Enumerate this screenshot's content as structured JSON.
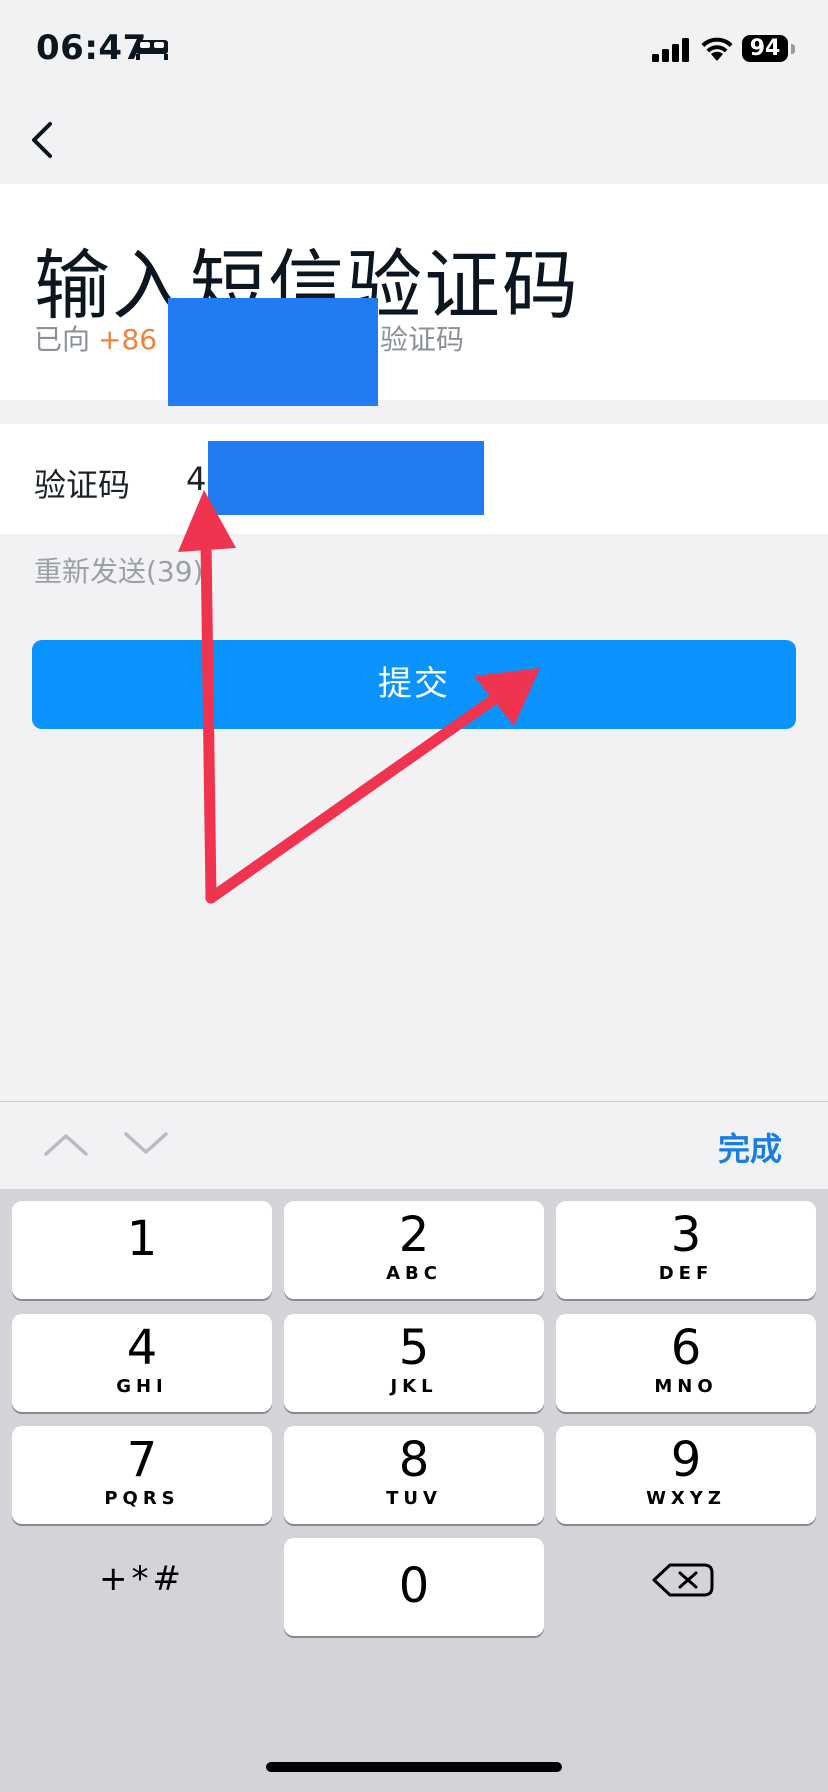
{
  "status_bar": {
    "time": "06:47",
    "battery_level": "94",
    "icons": [
      "sleep-focus-icon",
      "cellular-signal-icon",
      "wifi-icon",
      "battery-icon"
    ]
  },
  "nav": {
    "back_icon": "chevron-left-icon"
  },
  "header": {
    "title": "输入短信验证码",
    "sent_prefix": "已向",
    "sent_phone_visible": "+86 1",
    "sent_suffix": "验证码"
  },
  "form": {
    "code_label": "验证码",
    "code_value": "4",
    "resend_label": "重新发送(39)",
    "submit_label": "提交"
  },
  "annotation": {
    "arrow_color": "#f0344f"
  },
  "keyboard": {
    "accessory": {
      "prev_icon": "chevron-up-icon",
      "next_icon": "chevron-down-icon",
      "done_label": "完成"
    },
    "keys": [
      {
        "digit": "1",
        "letters": ""
      },
      {
        "digit": "2",
        "letters": "ABC"
      },
      {
        "digit": "3",
        "letters": "DEF"
      },
      {
        "digit": "4",
        "letters": "GHI"
      },
      {
        "digit": "5",
        "letters": "JKL"
      },
      {
        "digit": "6",
        "letters": "MNO"
      },
      {
        "digit": "7",
        "letters": "PQRS"
      },
      {
        "digit": "8",
        "letters": "TUV"
      },
      {
        "digit": "9",
        "letters": "WXYZ"
      },
      {
        "digit": "0",
        "letters": ""
      }
    ],
    "symbols_label": "+*#",
    "delete_icon": "backspace-icon"
  },
  "colors": {
    "accent_blue": "#0a93fd",
    "done_blue": "#1a7ee0",
    "phone_orange": "#f0823a",
    "redaction_blue": "#1f7cf3"
  }
}
